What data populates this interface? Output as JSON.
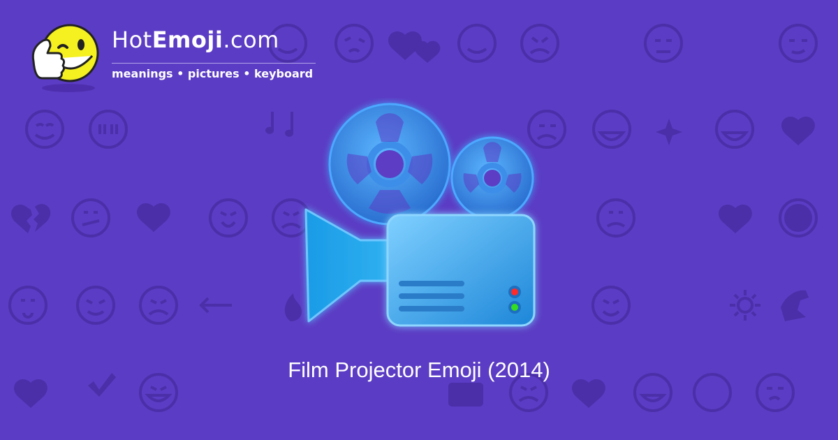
{
  "brand": {
    "name_hot": "Hot",
    "name_emoji": "Emoji",
    "name_tld": ".com",
    "tagline": "meanings • pictures • keyboard"
  },
  "caption": "Film Projector Emoji (2014)",
  "colors": {
    "background": "#5b3cc4",
    "pattern_emoji": "#4a2fa8",
    "projector_blue": "#2f9be8",
    "projector_light": "#7fd0ff",
    "reel_blue": "#3a86e0",
    "mascot_yellow": "#f5f020",
    "led_red": "#ff2a2a",
    "led_green": "#33dd22"
  },
  "hero_icon": "film-projector-icon",
  "mascot_icon": "winking-thumbs-up-icon"
}
